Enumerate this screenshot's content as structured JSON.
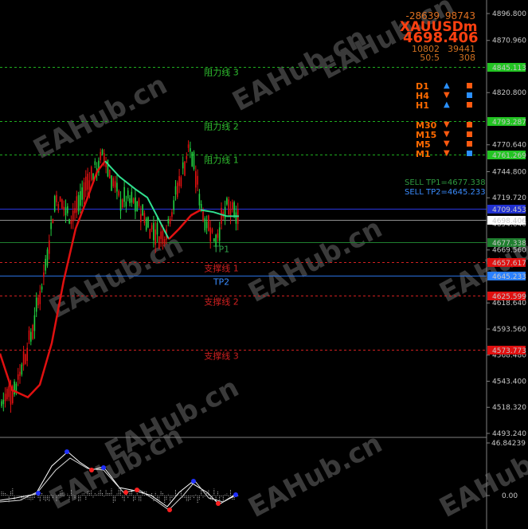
{
  "symbol": {
    "name": "XAUUSDm",
    "price": "4698.406",
    "top_left": "-28639",
    "top_right": "98743",
    "stat1_left": "10802",
    "stat1_right": "39441",
    "stat2_left": "50:5",
    "stat2_right": "308"
  },
  "price_axis": {
    "labels": [
      "4896.800",
      "4870.960",
      "4820.800",
      "4770.640",
      "4744.800",
      "4719.720",
      "4694.640",
      "4669.560",
      "4618.640",
      "4593.560",
      "4568.480",
      "4543.400",
      "4518.320",
      "4493.240"
    ]
  },
  "levels": [
    {
      "label": "阻力线 3",
      "tag": "4845.113",
      "color": "#1fae1f",
      "tag_bg": "#22c422",
      "tag_fg": "#000000",
      "style": "dashed",
      "text_color": "#2fbf2f"
    },
    {
      "label": "阻力线 2",
      "tag": "4793.287",
      "color": "#1fae1f",
      "tag_bg": "#22c422",
      "tag_fg": "#000000",
      "style": "dashed",
      "text_color": "#2fbf2f"
    },
    {
      "label": "阻力线 1",
      "tag": "4761.269",
      "color": "#1fae1f",
      "tag_bg": "#22c422",
      "tag_fg": "#000000",
      "style": "dashed",
      "text_color": "#2fbf2f"
    },
    {
      "label": "",
      "tag": "4709.453",
      "color": "#2a38e0",
      "tag_bg": "#2030d0",
      "tag_fg": "#7a88ff",
      "style": "solid",
      "text_color": "#2a38e0"
    },
    {
      "label": "",
      "tag": "4698.406",
      "color": "#909090",
      "tag_bg": "#ffffff",
      "tag_fg": "#000000",
      "style": "solid",
      "text_color": "#909090"
    },
    {
      "label": "TP1",
      "tag": "4677.338",
      "color": "#1f7f2f",
      "tag_bg": "#1f7f2f",
      "tag_fg": "#d0ffd0",
      "style": "solid",
      "text_color": "#2fa04a"
    },
    {
      "label": "支撑线 1",
      "tag": "4657.617",
      "color": "#d02020",
      "tag_bg": "#e01010",
      "tag_fg": "#ffffff",
      "style": "dashed",
      "text_color": "#d02020"
    },
    {
      "label": "TP2",
      "tag": "4645.233",
      "color": "#2a70e0",
      "tag_bg": "#2a80ff",
      "tag_fg": "#ffffff",
      "style": "solid",
      "text_color": "#3a8cff"
    },
    {
      "label": "支撑线 2",
      "tag": "4625.599",
      "color": "#d02020",
      "tag_bg": "#e01010",
      "tag_fg": "#ffffff",
      "style": "dashed",
      "text_color": "#d02020"
    },
    {
      "label": "支撑线 3",
      "tag": "4573.773",
      "color": "#d02020",
      "tag_bg": "#e01010",
      "tag_fg": "#ffffff",
      "style": "dashed",
      "text_color": "#d02020"
    }
  ],
  "timeframes": [
    {
      "name": "D1",
      "arrow": "▲",
      "arrow_color": "#2a90ff",
      "box_color": "#ff5a10"
    },
    {
      "name": "H4",
      "arrow": "▼",
      "arrow_color": "#ff5a10",
      "box_color": "#2a90ff"
    },
    {
      "name": "H1",
      "arrow": "▲",
      "arrow_color": "#2a90ff",
      "box_color": "#ff5a10"
    },
    {
      "name": "M30",
      "arrow": "▼",
      "arrow_color": "#ff5a10",
      "box_color": "#ff5a10"
    },
    {
      "name": "M15",
      "arrow": "▼",
      "arrow_color": "#ff5a10",
      "box_color": "#ff5a10"
    },
    {
      "name": "M5",
      "arrow": "▼",
      "arrow_color": "#ff5a10",
      "box_color": "#ff5a10"
    },
    {
      "name": "M1",
      "arrow": "▼",
      "arrow_color": "#ff5a10",
      "box_color": "#2a90ff"
    }
  ],
  "orders": {
    "sell_tp1": "SELL TP1=4677.338",
    "sell_tp2": "SELL TP2=4645.233"
  },
  "indicator": {
    "top_label": "46.84239",
    "zero_label": "0.00"
  },
  "watermark": "EAHub.cn",
  "colors": {
    "bull": "#22d040",
    "bear": "#e01010",
    "ma_up": "#30e090",
    "ma_down": "#e01010"
  }
}
